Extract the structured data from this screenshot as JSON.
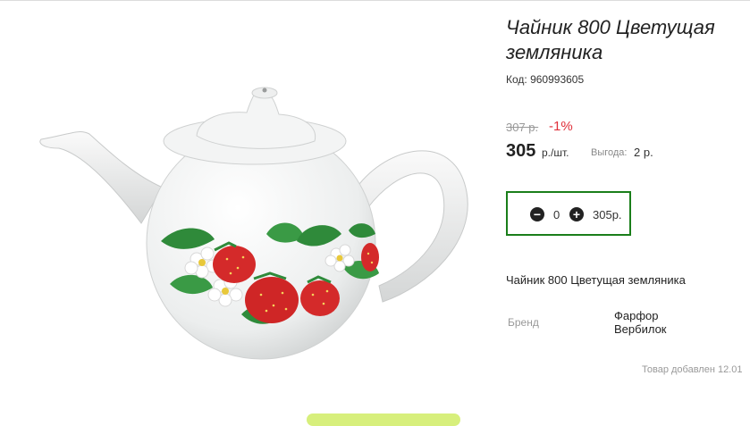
{
  "product": {
    "title": "Чайник 800 Цветущая земляника",
    "code": "Код: 960993605",
    "old_price": "307 р.",
    "discount": "-1%",
    "price": "305",
    "price_unit": "р./шт.",
    "benefit_label": "Выгода:",
    "benefit_value": "2 р.",
    "description": "Чайник 800 Цветущая земляника",
    "brand_label": "Бренд",
    "brand_value": "Фарфор Вербилок",
    "added_text": "Товар добавлен 12.01"
  },
  "cart": {
    "quantity": "0",
    "total": "305р.",
    "minus_icon": "minus-circle",
    "plus_icon": "plus-circle"
  },
  "colors": {
    "discount": "#e0303a",
    "qty_border": "#1a7e1a",
    "strawberry": "#d42a2a",
    "leaf": "#2f8a3a"
  }
}
